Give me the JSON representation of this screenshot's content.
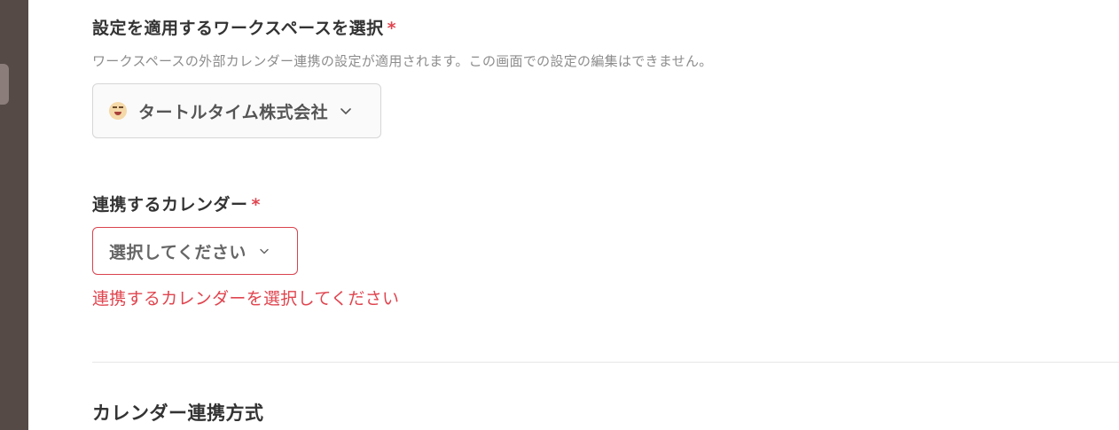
{
  "workspace_field": {
    "label": "設定を適用するワークスペースを選択",
    "required_mark": "*",
    "description": "ワークスペースの外部カレンダー連携の設定が適用されます。この画面での設定の編集はできません。",
    "selected_value": "タートルタイム株式会社",
    "icon": "grinning-face-emoji"
  },
  "calendar_field": {
    "label": "連携するカレンダー",
    "required_mark": "*",
    "placeholder": "選択してください",
    "error_message": "連携するカレンダーを選択してください"
  },
  "section": {
    "title": "カレンダー連携方式"
  },
  "colors": {
    "sidebar": "#554a46",
    "required": "#e0454f",
    "error_border": "#d9434e",
    "label_text": "#333333",
    "description_text": "#8c8c8c"
  }
}
